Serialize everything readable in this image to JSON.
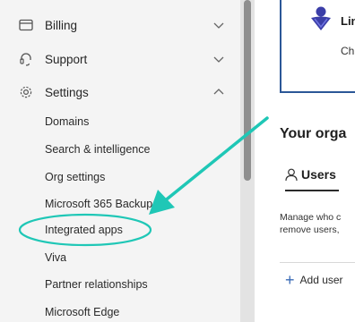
{
  "sidebar": {
    "items": [
      {
        "label": "Billing",
        "icon": "billing-icon",
        "expanded": false
      },
      {
        "label": "Support",
        "icon": "headset-icon",
        "expanded": false
      },
      {
        "label": "Settings",
        "icon": "gear-icon",
        "expanded": true
      }
    ],
    "settings_subitems": [
      "Domains",
      "Search & intelligence",
      "Org settings",
      "Microsoft 365 Backup",
      "Integrated apps",
      "Viva",
      "Partner relationships",
      "Microsoft Edge"
    ]
  },
  "main": {
    "card_title": "Lin",
    "card_subtitle": "Ch",
    "org_heading": "Your orga",
    "users_tab": "Users",
    "description_line1": "Manage who c",
    "description_line2": "remove users,",
    "add_user": "Add user"
  },
  "annotation": {
    "color": "#1fc7b6",
    "target": "Integrated apps"
  },
  "colors": {
    "sidebar_bg": "#f4f4f4",
    "accent": "#2b5797",
    "highlight": "#1fc7b6"
  }
}
